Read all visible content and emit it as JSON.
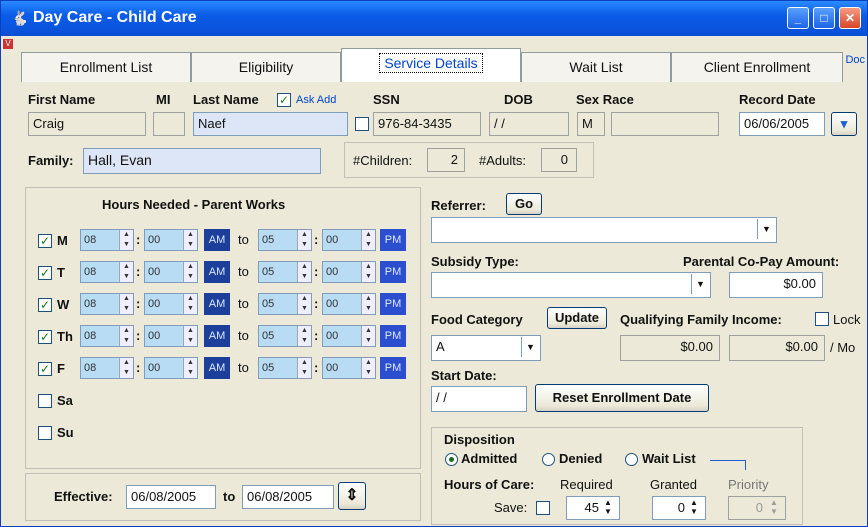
{
  "window": {
    "title": "Day Care - Child Care",
    "min": "_",
    "max": "□",
    "close": "✕",
    "doc": "Doc",
    "corner": "V"
  },
  "tabs": [
    "Enrollment List",
    "Eligibility",
    "Service Details",
    "Wait List",
    "Client Enrollment"
  ],
  "person": {
    "first_label": "First Name",
    "first": "Craig",
    "mi_label": "MI",
    "mi": "",
    "last_label": "Last Name",
    "ask_add": "Ask Add",
    "last": "Naef",
    "ssn_label": "SSN",
    "ssn": "976-84-3435",
    "dob_label": "DOB",
    "dob": " / /",
    "sexrace_label": "Sex Race",
    "sex": "M",
    "race": "",
    "record_label": "Record Date",
    "record": "06/06/2005"
  },
  "family": {
    "label": "Family:",
    "value": "Hall, Evan",
    "children_label": "#Children:",
    "children": "2",
    "adults_label": "#Adults:",
    "adults": "0"
  },
  "hours": {
    "title": "Hours Needed - Parent Works",
    "to": "to",
    "am": "AM",
    "pm": "PM",
    "days": [
      {
        "label": "M",
        "checked": true,
        "h1": "08",
        "m1": "00",
        "h2": "05",
        "m2": "00"
      },
      {
        "label": "T",
        "checked": true,
        "h1": "08",
        "m1": "00",
        "h2": "05",
        "m2": "00"
      },
      {
        "label": "W",
        "checked": true,
        "h1": "08",
        "m1": "00",
        "h2": "05",
        "m2": "00"
      },
      {
        "label": "Th",
        "checked": true,
        "h1": "08",
        "m1": "00",
        "h2": "05",
        "m2": "00"
      },
      {
        "label": "F",
        "checked": true,
        "h1": "08",
        "m1": "00",
        "h2": "05",
        "m2": "00"
      },
      {
        "label": "Sa",
        "checked": false
      },
      {
        "label": "Su",
        "checked": false
      }
    ]
  },
  "effective": {
    "label": "Effective:",
    "from": "06/08/2005",
    "to_label": "to",
    "to": "06/08/2005"
  },
  "referrer": {
    "label": "Referrer:",
    "go": "Go",
    "value": ""
  },
  "subsidy": {
    "label": "Subsidy Type:",
    "value": "",
    "copay_label": "Parental Co-Pay Amount:",
    "copay": "$0.00"
  },
  "food": {
    "label": "Food Category",
    "update": "Update",
    "value": "A",
    "income_label": "Qualifying Family Income:",
    "lock": "Lock",
    "income1": "$0.00",
    "income2": "$0.00",
    "per": "/ Mo"
  },
  "start": {
    "label": "Start Date:",
    "value": " / /",
    "reset": "Reset Enrollment Date"
  },
  "disposition": {
    "label": "Disposition",
    "options": [
      "Admitted",
      "Denied",
      "Wait List"
    ],
    "selected": "Admitted",
    "hours_label": "Hours of Care:",
    "required_label": "Required",
    "granted_label": "Granted",
    "priority_label": "Priority",
    "save_label": "Save:",
    "required": "45",
    "granted": "0",
    "priority": "0"
  }
}
